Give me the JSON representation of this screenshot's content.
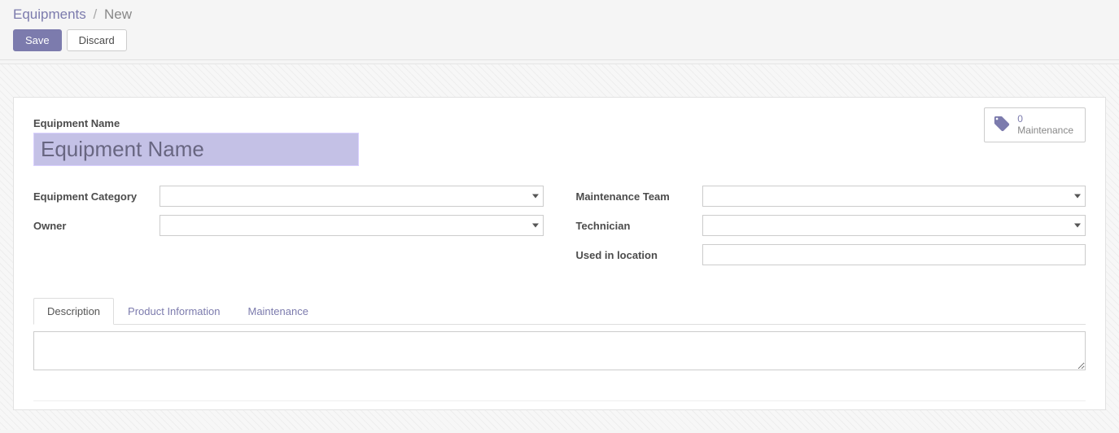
{
  "breadcrumb": {
    "parent": "Equipments",
    "sep": "/",
    "current": "New"
  },
  "actions": {
    "save": "Save",
    "discard": "Discard"
  },
  "stat": {
    "count": "0",
    "label": "Maintenance"
  },
  "form": {
    "name_label": "Equipment Name",
    "name_placeholder": "Equipment Name",
    "name_value": "",
    "left": {
      "category_label": "Equipment Category",
      "category_value": "",
      "owner_label": "Owner",
      "owner_value": ""
    },
    "right": {
      "team_label": "Maintenance Team",
      "team_value": "",
      "technician_label": "Technician",
      "technician_value": "",
      "location_label": "Used in location",
      "location_value": ""
    }
  },
  "tabs": {
    "description": "Description",
    "product_info": "Product Information",
    "maintenance": "Maintenance"
  },
  "description_value": ""
}
